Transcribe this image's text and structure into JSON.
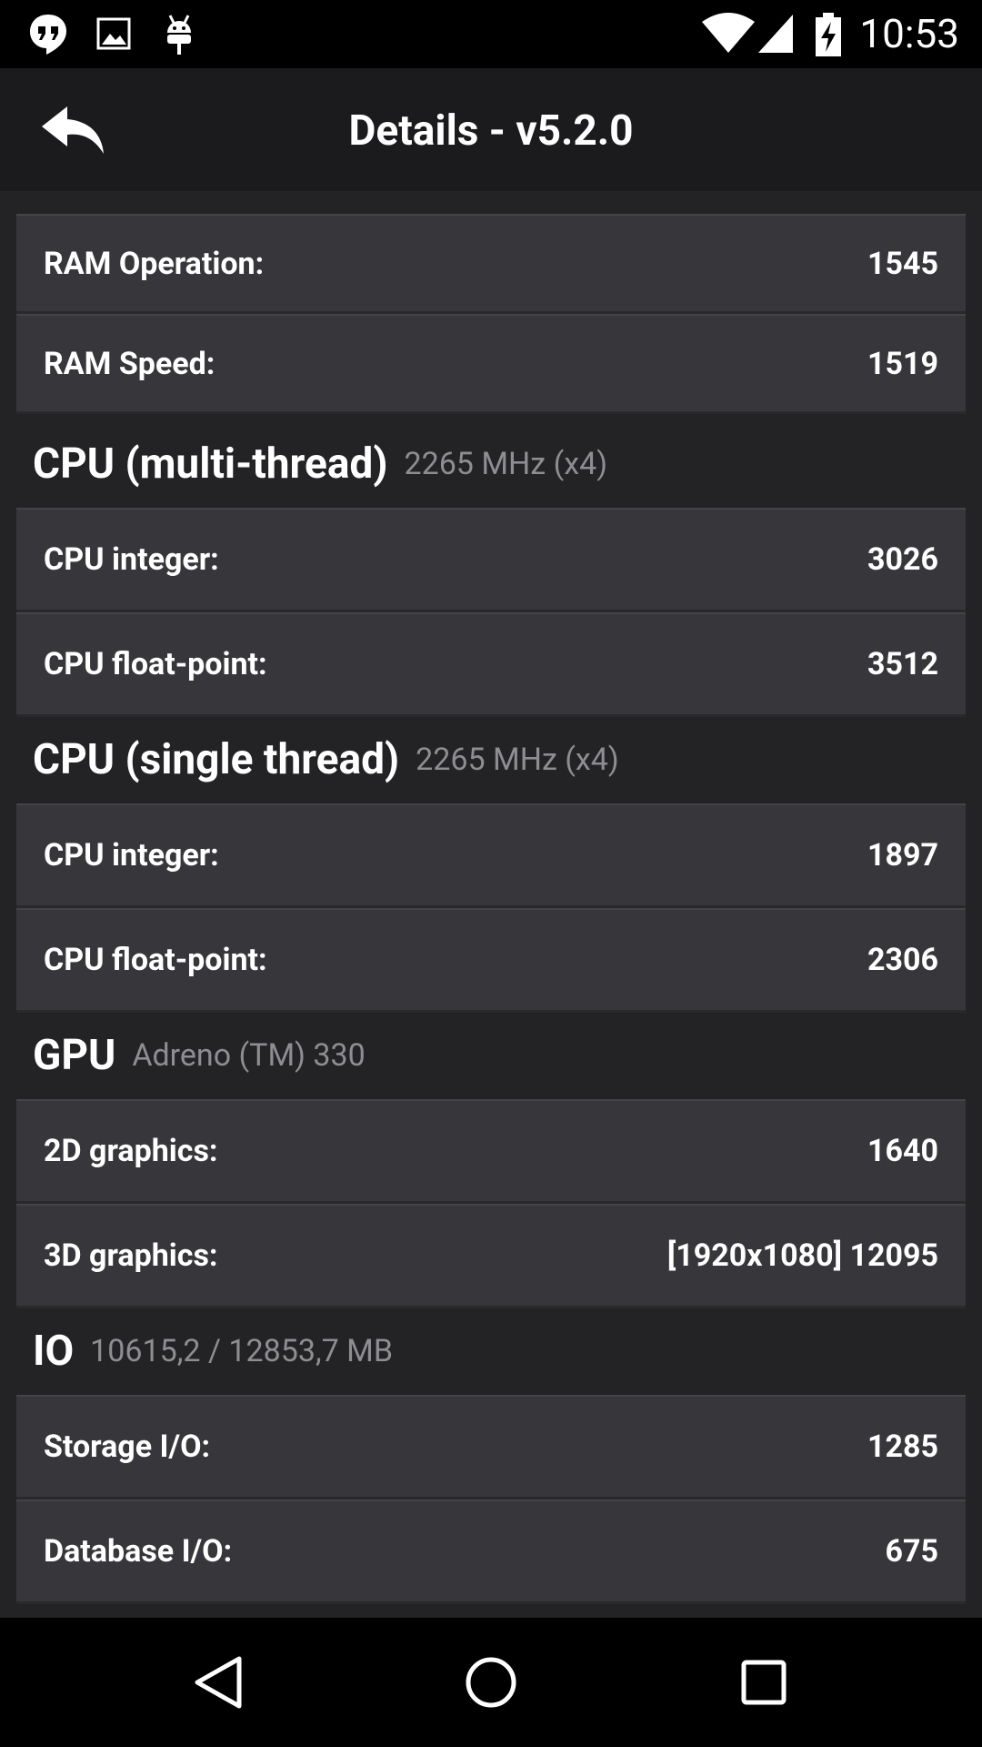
{
  "status_bar": {
    "time": "10:53",
    "icons_left": [
      "hangouts-icon",
      "image-icon",
      "android-icon"
    ],
    "icons_right": [
      "wifi-icon",
      "cell-signal-icon",
      "battery-charging-icon"
    ]
  },
  "app_bar": {
    "title": "Details - v5.2.0",
    "back_icon": "back-arrow-icon"
  },
  "sections": {
    "memory": {
      "rows": [
        {
          "label": "RAM Operation:",
          "value": "1545"
        },
        {
          "label": "RAM Speed:",
          "value": "1519"
        }
      ]
    },
    "cpu_multi": {
      "title": "CPU (multi-thread)",
      "detail": "2265 MHz (x4)",
      "rows": [
        {
          "label": "CPU integer:",
          "value": "3026"
        },
        {
          "label": "CPU float-point:",
          "value": "3512"
        }
      ]
    },
    "cpu_single": {
      "title": "CPU (single thread)",
      "detail": "2265 MHz (x4)",
      "rows": [
        {
          "label": "CPU integer:",
          "value": "1897"
        },
        {
          "label": "CPU float-point:",
          "value": "2306"
        }
      ]
    },
    "gpu": {
      "title": "GPU",
      "detail": "Adreno (TM) 330",
      "rows": [
        {
          "label": "2D graphics:",
          "value": "1640"
        },
        {
          "label": "3D graphics:",
          "value": "[1920x1080] 12095"
        }
      ]
    },
    "io": {
      "title": "IO",
      "detail": "10615,2 / 12853,7 MB",
      "rows": [
        {
          "label": "Storage I/O:",
          "value": "1285"
        },
        {
          "label": "Database I/O:",
          "value": "675"
        }
      ]
    }
  },
  "nav_bar": {
    "icons": [
      "back-triangle-icon",
      "home-circle-icon",
      "recents-square-icon"
    ]
  },
  "colors": {
    "background": "#232326",
    "card": "#37373b",
    "app_bar": "#1b1b1d",
    "secondary_text": "#8e8e92"
  }
}
